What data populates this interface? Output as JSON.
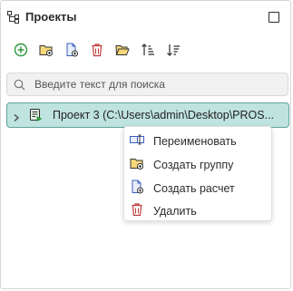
{
  "panel": {
    "title": "Проекты"
  },
  "toolbar": {
    "buttons": [
      {
        "icon": "add-circle-icon"
      },
      {
        "icon": "create-group-icon"
      },
      {
        "icon": "create-calc-icon"
      },
      {
        "icon": "delete-icon"
      },
      {
        "icon": "open-folder-icon"
      },
      {
        "icon": "sort-ascending-icon"
      },
      {
        "icon": "sort-descending-icon"
      }
    ]
  },
  "search": {
    "placeholder": "Введите текст для поиска",
    "value": ""
  },
  "tree": {
    "project": {
      "label": "Проект 3 (C:\\Users\\admin\\Desktop\\PROS..."
    }
  },
  "context_menu": {
    "items": [
      {
        "label": "Переименовать",
        "icon": "rename-icon"
      },
      {
        "label": "Создать группу",
        "icon": "create-group-icon"
      },
      {
        "label": "Создать расчет",
        "icon": "create-calc-icon"
      },
      {
        "label": "Удалить",
        "icon": "delete-icon"
      }
    ]
  },
  "colors": {
    "accent_green": "#2e9a3f",
    "folder_yellow": "#e6b93f",
    "doc_blue": "#3b5fc0",
    "delete_red": "#c0393b",
    "selection_bg": "#bfe3df",
    "selection_border": "#5fa59c"
  }
}
